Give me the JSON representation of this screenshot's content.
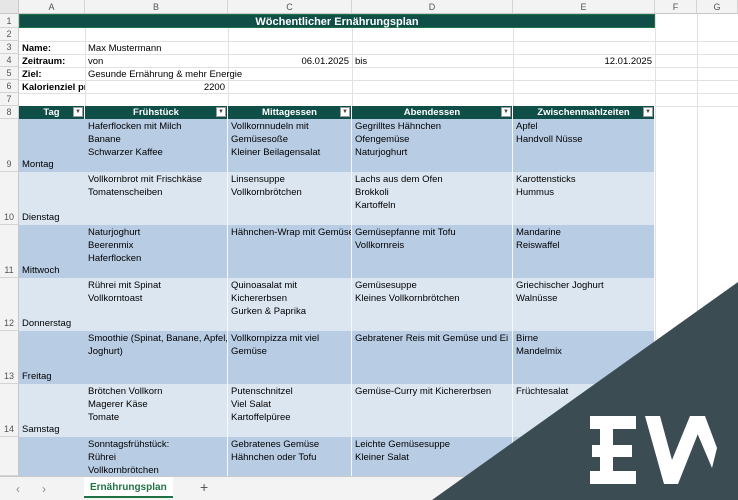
{
  "columns": [
    "A",
    "B",
    "C",
    "D",
    "E",
    "F",
    "G"
  ],
  "rows": [
    "1",
    "2",
    "3",
    "4",
    "5",
    "6",
    "7",
    "8",
    "9",
    "10",
    "11",
    "12",
    "13",
    "14"
  ],
  "title": "Wöchentlicher Ernährungsplan",
  "info": {
    "name_label": "Name:",
    "name_value": "Max Mustermann",
    "period_label": "Zeitraum:",
    "period_from": "von",
    "period_start": "06.01.2025",
    "period_to": "bis",
    "period_end": "12.01.2025",
    "goal_label": "Ziel:",
    "goal_value": "Gesunde Ernährung & mehr Energie",
    "calorie_label": "Kalorienziel pro",
    "calorie_value": "2200"
  },
  "table": {
    "headers": [
      "Tag",
      "Frühstück",
      "Mittagessen",
      "Abendessen",
      "Zwischenmahlzeiten"
    ],
    "rows": [
      {
        "day": "Montag",
        "breakfast": "Haferflocken mit Milch\nBanane\nSchwarzer Kaffee",
        "lunch": "Vollkornnudeln mit\nGemüsesoße\nKleiner Beilagensalat",
        "dinner": "Gegrilltes Hähnchen\nOfengemüse\nNaturjoghurt",
        "snacks": "Apfel\nHandvoll Nüsse"
      },
      {
        "day": "Dienstag",
        "breakfast": "Vollkornbrot mit Frischkäse\nTomatenscheiben",
        "lunch": "Linsensuppe\nVollkornbrötchen",
        "dinner": "Lachs aus dem Ofen\nBrokkoli\nKartoffeln",
        "snacks": "Karottensticks\nHummus"
      },
      {
        "day": "Mittwoch",
        "breakfast": "Naturjoghurt\nBeerenmix\nHaferflocken",
        "lunch": "Hähnchen-Wrap mit Gemüse",
        "dinner": "Gemüsepfanne mit Tofu\nVollkornreis",
        "snacks": "Mandarine\nReiswaffel"
      },
      {
        "day": "Donnerstag",
        "breakfast": "Rührei mit Spinat\nVollkorntoast",
        "lunch": "Quinoasalat mit\nKichererbsen\nGurken & Paprika",
        "dinner": "Gemüsesuppe\nKleines Vollkornbrötchen",
        "snacks": "Griechischer Joghurt\nWalnüsse"
      },
      {
        "day": "Freitag",
        "breakfast": "Smoothie (Spinat, Banane, Apfel,\nJoghurt)",
        "lunch": "Vollkornpizza mit viel\nGemüse",
        "dinner": "Gebratener Reis mit Gemüse und Ei",
        "snacks": "Birne\nMandelmix"
      },
      {
        "day": "Samstag",
        "breakfast": "Brötchen Vollkorn\nMagerer Käse\nTomate",
        "lunch": "Putenschnitzel\nViel Salat\nKartoffelpüree",
        "dinner": "Gemüse-Curry mit Kichererbsen",
        "snacks": "Früchtesalat"
      },
      {
        "day": "",
        "breakfast": "Sonntagsfrühstück:\nRührei\nVollkornbrötchen",
        "lunch": "Gebratenes Gemüse\nHähnchen oder Tofu",
        "dinner": "Leichte Gemüsesuppe\nKleiner Salat",
        "snacks": ""
      }
    ]
  },
  "sheet_tab": "Ernährungsplan",
  "add_sheet": "+",
  "nav_prev": "‹",
  "nav_next": "›",
  "colors": {
    "header_fill": "#0f4f48",
    "band_dark": "#b8cce4",
    "band_light": "#dce6f1",
    "overlay": "#3c4c53"
  }
}
